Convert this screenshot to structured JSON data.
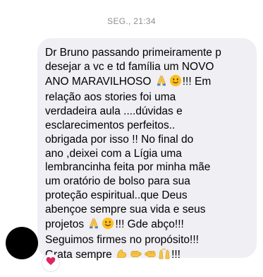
{
  "timestamp": "SEG., 21:34",
  "message": {
    "lines": [
      {
        "text": "Dr Bruno passando primeiramente p"
      },
      {
        "text": "desejar a vc e td família um NOVO"
      },
      {
        "text": "ANO MARAVILHOSO ",
        "emoji": [
          "folded-hands-icon",
          "smiling-face-icon"
        ],
        "after": "!!! Em"
      },
      {
        "text": "relação aos stories foi uma"
      },
      {
        "text": "verdadeira aula ....dúvidas e"
      },
      {
        "text": "esclarecimentos perfeitos.."
      },
      {
        "text": "obrigada por isso !! No final do"
      },
      {
        "text": "ano ,deixei com a Lígia uma"
      },
      {
        "text": "lembrancinha feita por minha mãe"
      },
      {
        "text": "um oratório de bolso para sua"
      },
      {
        "text": "proteção espiritual..que Deus"
      },
      {
        "text": "abençoe sempre sua vida e seus"
      },
      {
        "text": "projetos ",
        "emoji": [
          "folded-hands-icon",
          "smiling-face-icon"
        ],
        "after": "!!! Gde abço!!!"
      },
      {
        "text": "Seguimos firmes no propósito!!!"
      },
      {
        "text": "Grata sempre ",
        "emoji": [
          "flexed-biceps-icon",
          "fist-bump-icon",
          "fist-bump-icon",
          "raising-hands-icon"
        ],
        "after": "!!!"
      }
    ]
  },
  "reaction": {
    "icon": "red-heart-icon",
    "color": "#e0245e"
  },
  "colors": {
    "bubble": "#efeff4",
    "timestamp": "#8e8e93",
    "avatar": "#000000"
  }
}
